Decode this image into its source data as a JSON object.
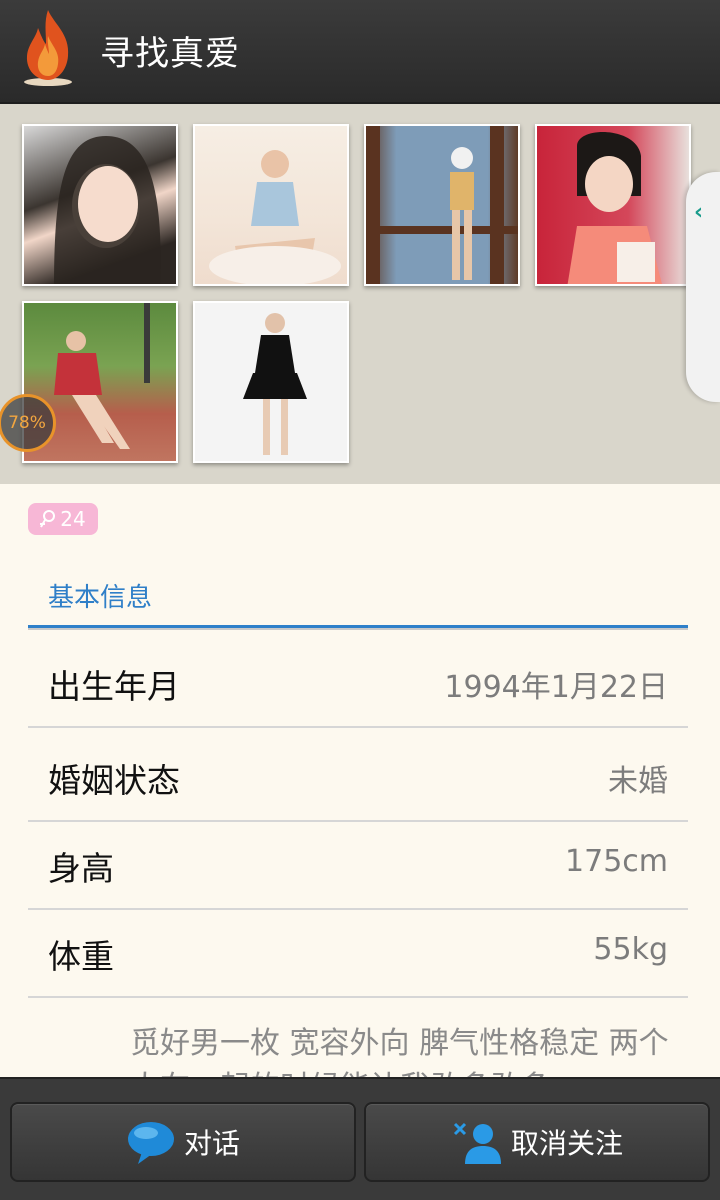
{
  "header": {
    "title": "寻找真爱"
  },
  "profile": {
    "completion": "78%",
    "age": "24"
  },
  "section": {
    "title": "基本信息"
  },
  "info_rows": [
    {
      "label": "出生年月",
      "value": "1994年1月22日"
    },
    {
      "label": "婚姻状态",
      "value": "未婚"
    },
    {
      "label": "身高",
      "value": "175cm"
    },
    {
      "label": "体重",
      "value": "55kg"
    }
  ],
  "bio": "觅好男一枚  宽容外向  脾气性格稳定 两个人在一起的时候能让我敢多敢多",
  "actions": {
    "chat_label": "对话",
    "unfollow_label": "取消关注"
  },
  "colors": {
    "accent": "#2f80c9",
    "header_bg": "#333333",
    "badge_pink": "#f7b7d6",
    "progress_orange": "#e8932a"
  }
}
